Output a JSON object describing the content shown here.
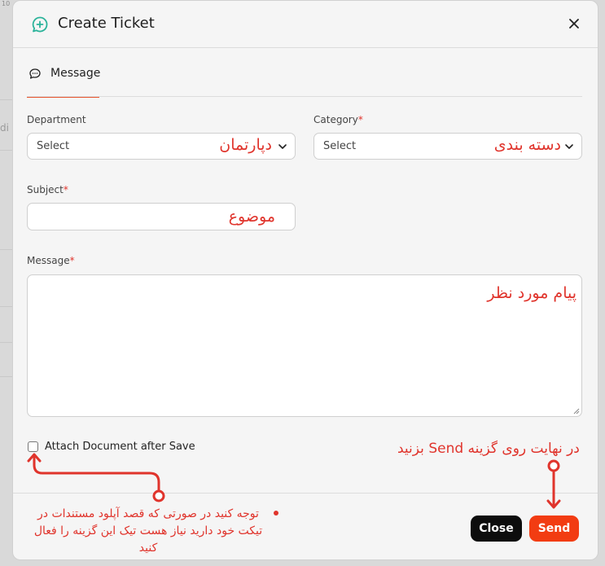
{
  "background": {
    "top_label": "10",
    "side_text": "di"
  },
  "modal": {
    "title": "Create Ticket",
    "title_icon": "chat-plus-icon",
    "close_icon": "close-icon"
  },
  "tabs": [
    {
      "label": "Message",
      "icon": "chat-bubble-icon",
      "active": true
    }
  ],
  "form": {
    "department": {
      "label": "Department",
      "placeholder": "Select",
      "annotation": "دپارتمان"
    },
    "category": {
      "label": "Category",
      "required_mark": "*",
      "placeholder": "Select",
      "annotation": "دسته بندی"
    },
    "subject": {
      "label": "Subject",
      "required_mark": "*",
      "value": "",
      "annotation": "موضوع"
    },
    "message": {
      "label": "Message",
      "required_mark": "*",
      "value": "",
      "annotation": "پیام مورد نظر"
    },
    "attach": {
      "label": "Attach Document after Save",
      "checked": false
    }
  },
  "buttons": {
    "close_label": "Close",
    "send_label": "Send"
  },
  "annotations": {
    "send_hint": "در نهایت روی گزینه Send بزنید",
    "attach_note": "توجه کنید در صورتی که قصد آپلود مستندات در تیکت خود دارید نیاز هست تیک این گزینه را فعال کنید"
  },
  "colors": {
    "accent": "#e8542d",
    "send": "#f23c12",
    "close": "#0d0d0d",
    "annotation": "#e0342c",
    "icon_teal": "#2bb39a"
  }
}
